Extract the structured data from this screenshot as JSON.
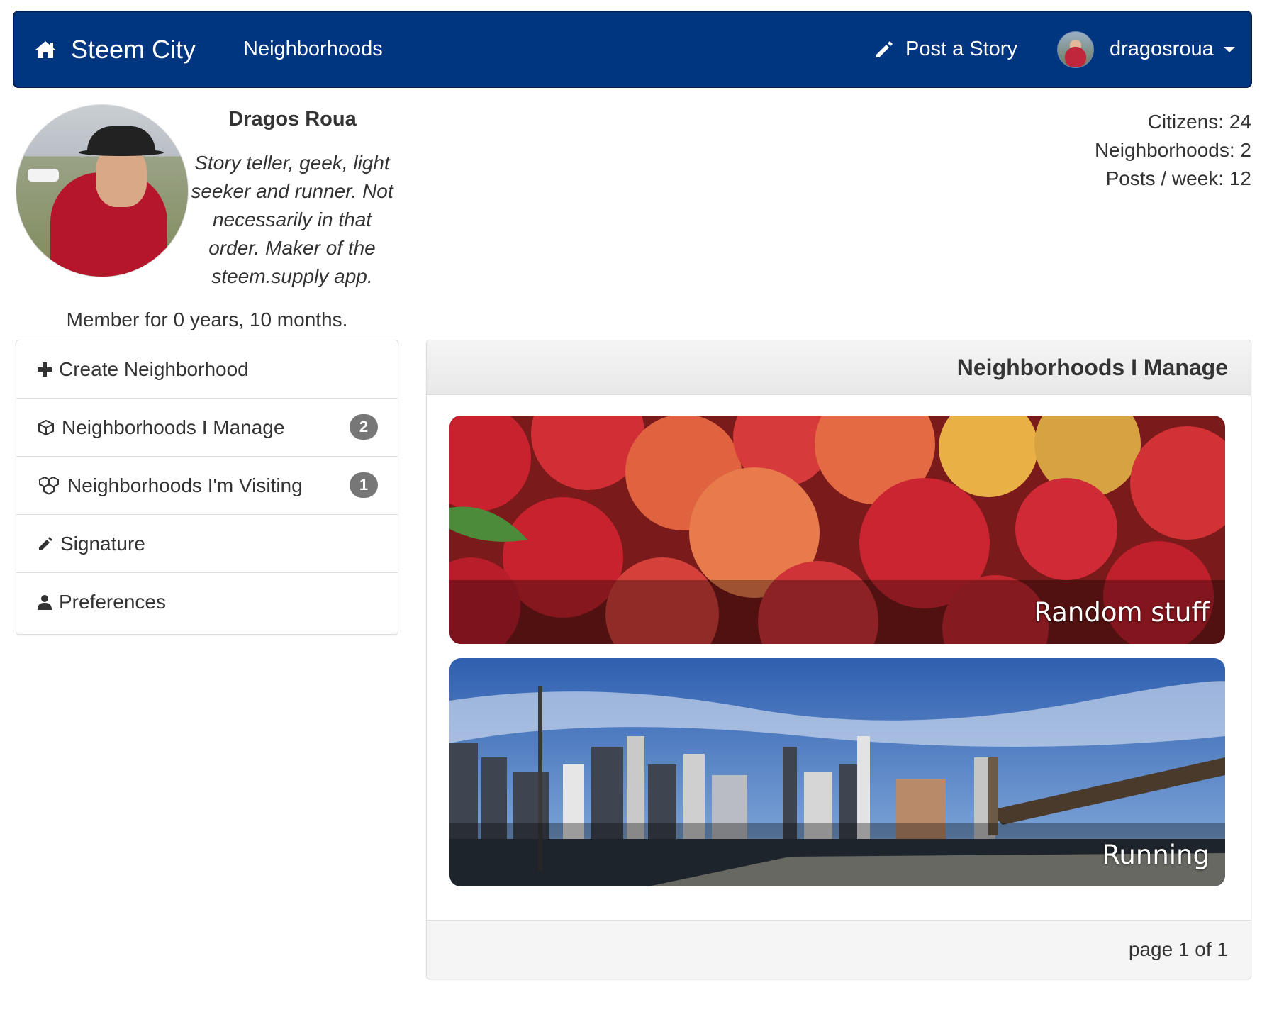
{
  "navbar": {
    "brand": "Steem City",
    "brand_icon": "home-icon",
    "neighborhoods_link": "Neighborhoods",
    "post_story": "Post a Story",
    "post_icon": "pencil-icon",
    "username": "dragosroua"
  },
  "profile": {
    "name": "Dragos Roua",
    "bio": "Story teller, geek, light seeker and runner. Not necessarily in that order. Maker of the steem.supply app.",
    "member_since": "Member for 0 years, 10 months."
  },
  "stats": {
    "citizens": "Citizens: 24",
    "neighborhoods": "Neighborhoods: 2",
    "posts_per_week": "Posts / week: 12"
  },
  "side_menu": {
    "items": [
      {
        "label": "Create Neighborhood",
        "icon": "plus-icon"
      },
      {
        "label": "Neighborhoods I Manage",
        "icon": "cube-icon",
        "badge": "2"
      },
      {
        "label": "Neighborhoods I'm Visiting",
        "icon": "cubes-icon",
        "badge": "1"
      },
      {
        "label": "Signature",
        "icon": "pencil-icon"
      },
      {
        "label": "Preferences",
        "icon": "user-icon"
      }
    ]
  },
  "panel": {
    "title": "Neighborhoods I Manage",
    "cards": [
      {
        "title": "Random stuff",
        "image": "apples"
      },
      {
        "title": "Running",
        "image": "city-skyline"
      }
    ],
    "pagination": "page 1 of 1"
  },
  "colors": {
    "navbar_bg": "#003580",
    "badge_bg": "#777777",
    "panel_header_bg": "#eeeeee"
  }
}
